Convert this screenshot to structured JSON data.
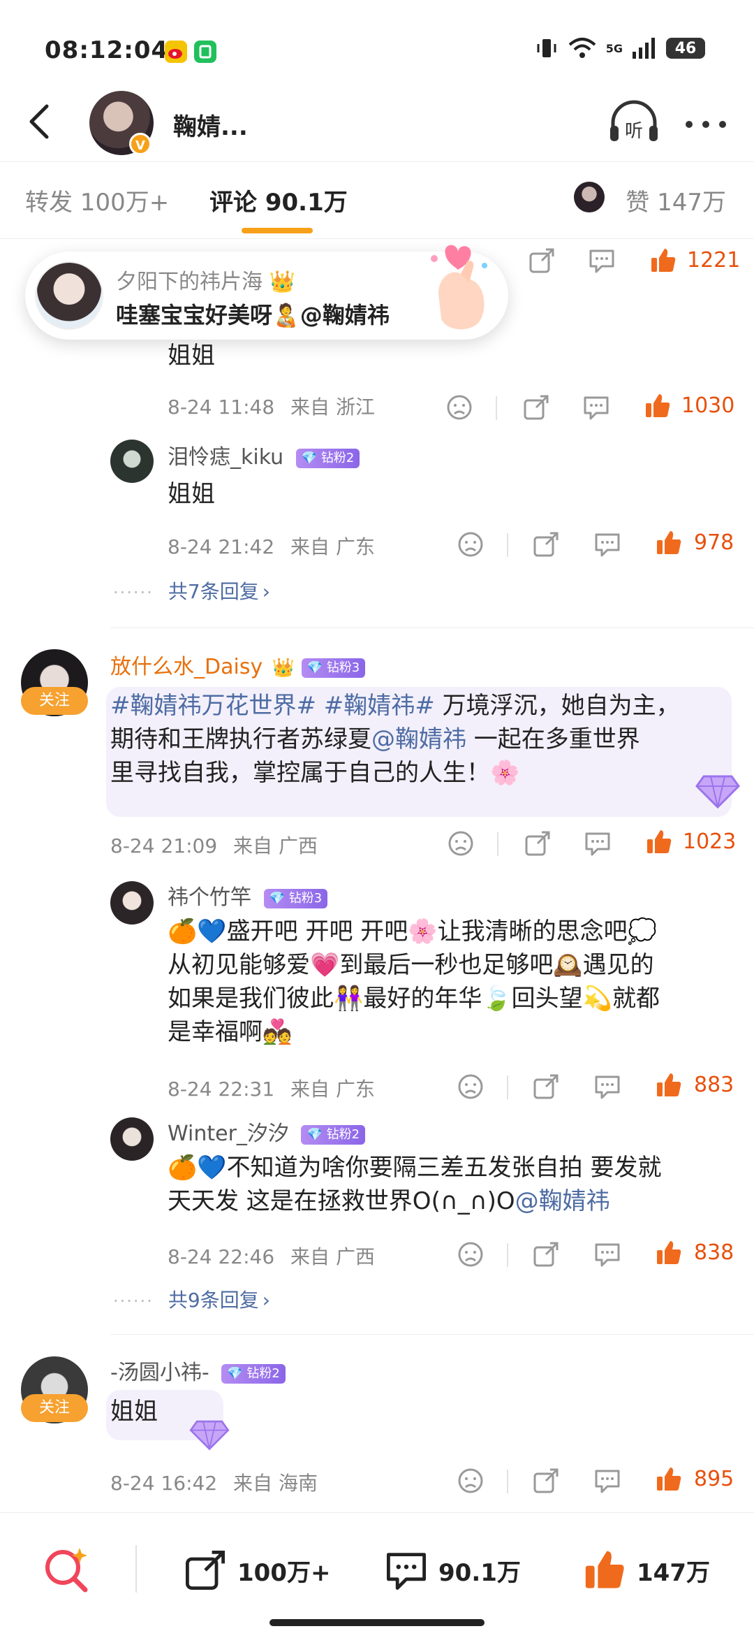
{
  "status_bar": {
    "time": "08:12:04",
    "network": "5G",
    "battery": "46"
  },
  "header": {
    "title": "鞠婧...",
    "listen_label": "听"
  },
  "tabs": {
    "repost": "转发 100万+",
    "comment": "评论 90.1万",
    "like": "赞 147万"
  },
  "toast": {
    "name": "夕阳下的祎片海",
    "text": "哇塞宝宝好美呀🧑‍🍼@鞠婧祎"
  },
  "comments": [
    {
      "partial_top": true,
      "like_count": "1221",
      "replies": [
        {
          "text": "姐姐",
          "time": "8-24 11:48",
          "location": "来自 浙江",
          "like_count": "1030"
        },
        {
          "name": "泪怜痣_kiku",
          "badge": "钻粉2",
          "text": "姐姐",
          "time": "8-24 21:42",
          "location": "来自 广东",
          "like_count": "978"
        }
      ],
      "more_replies": "共7条回复"
    },
    {
      "name": "放什么水_Daisy",
      "badge": "钻粉3",
      "follow": "关注",
      "text_topic": "#鞠婧祎万花世界# #鞠婧祎#",
      "text_1": " 万境浮沉，她自为主，",
      "text_2": "期待和王牌执行者苏绿夏",
      "text_mention": "@鞠婧祎",
      "text_3": " 一起在多重世界",
      "text_4": "里寻找自我，掌控属于自己的人生！🌸",
      "time": "8-24 21:09",
      "location": "来自 广西",
      "like_count": "1023",
      "replies": [
        {
          "name": "祎个竹竿",
          "badge": "钻粉3",
          "line1": "🍊💙盛开吧 开吧 开吧🌸让我清晰的思念吧💭",
          "line2": "从初见能够爱💗到最后一秒也足够吧🕰️遇见的",
          "line3": "如果是我们彼此👭最好的年华🍃回头望💫就都",
          "line4": "是幸福啊💑",
          "time": "8-24 22:31",
          "location": "来自 广东",
          "like_count": "883"
        },
        {
          "name": "Winter_汐汐",
          "badge": "钻粉2",
          "line1": "🍊💙不知道为啥你要隔三差五发张自拍 要发就",
          "line2": "天天发 这是在拯救世界O(∩_∩)O",
          "mention": "@鞠婧祎",
          "time": "8-24 22:46",
          "location": "来自 广西",
          "like_count": "838"
        }
      ],
      "more_replies": "共9条回复"
    },
    {
      "name": "-汤圆小祎-",
      "badge": "钻粉2",
      "follow": "关注",
      "text": "姐姐",
      "time": "8-24 16:42",
      "location": "来自 海南",
      "like_count": "895"
    }
  ],
  "bottom_bar": {
    "repost_count": "100万+",
    "comment_count": "90.1万",
    "like_count": "147万"
  },
  "colors": {
    "accent": "#f7a11a",
    "like": "#e8500c",
    "link": "#4e6ca3",
    "fan_badge": "#9b74ec"
  }
}
